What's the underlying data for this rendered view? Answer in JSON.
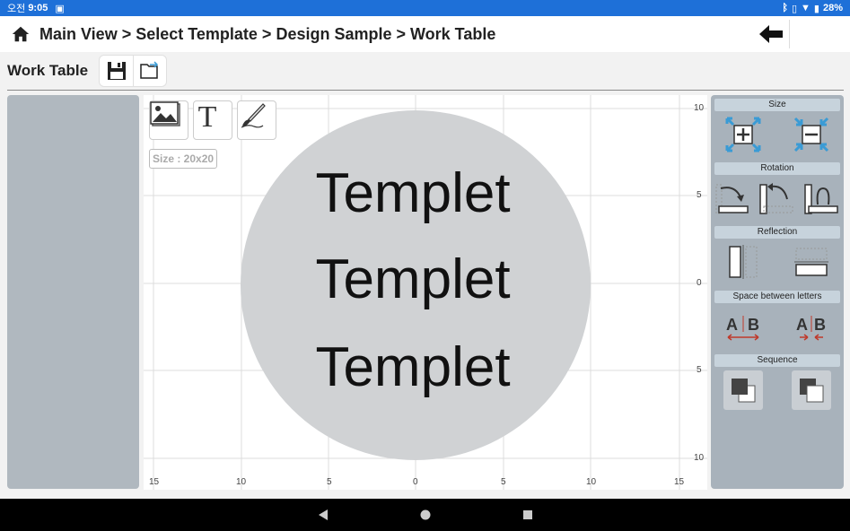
{
  "status": {
    "time_prefix": "오전",
    "time": "9:05",
    "battery": "28%"
  },
  "header": {
    "breadcrumb": "Main View > Select Template > Design Sample > Work Table"
  },
  "subheader": {
    "title": "Work Table"
  },
  "canvas": {
    "size_label": "Size : 20x20",
    "text_lines": [
      "Templet",
      "Templet",
      "Templet"
    ],
    "x_ticks": [
      "15",
      "10",
      "5",
      "0",
      "5",
      "10",
      "15"
    ],
    "y_ticks": [
      "10",
      "5",
      "0",
      "5",
      "10"
    ],
    "circle_color": "#d0d2d4"
  },
  "tools": {
    "sections": {
      "size": "Size",
      "rotation": "Rotation",
      "reflection": "Reflection",
      "spacing": "Space between letters",
      "sequence": "Sequence"
    }
  },
  "colors": {
    "status_bar": "#1e70d8",
    "panel": "#a8b2bb",
    "left_panel": "#b0b8bf",
    "accent_icon": "#3a9bd5"
  }
}
